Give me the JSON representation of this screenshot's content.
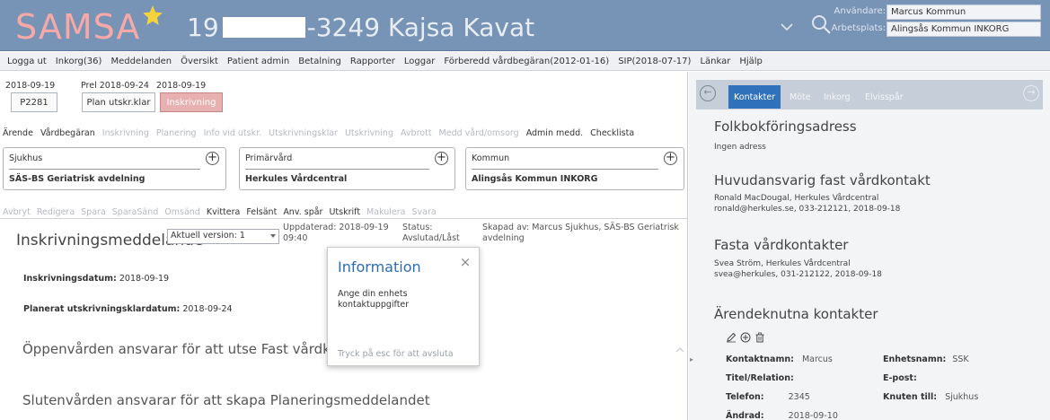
{
  "header": {
    "logo": "SAMSA",
    "pnr_prefix": "19",
    "pnr_suffix": "-3249 Kajsa Kavat",
    "user_label": "Användare:",
    "user_value": "Marcus Kommun",
    "workplace_label": "Arbetsplats:",
    "workplace_value": "Alingsås Kommun INKORG",
    "icons": [
      "star-icon",
      "chevron-down-icon",
      "search-icon"
    ],
    "colors": {
      "bar": "#7793b6",
      "logo": "#f6a9a6",
      "star": "#f7d33a"
    }
  },
  "menu": [
    "Logga ut",
    "Inkorg(36)",
    "Meddelanden",
    "Översikt",
    "Patient admin",
    "Betalning",
    "Rapporter",
    "Loggar",
    "Förberedd vårdbegäran(2012-01-16)",
    "SIP(2018-07-17)",
    "Länkar",
    "Hjälp"
  ],
  "dates": {
    "d1": "2018-09-19",
    "d2": "Prel 2018-09-24",
    "d3": "2018-09-19",
    "b1": "P2281",
    "b2": "Plan utskr.klar",
    "b3": "Inskrivning"
  },
  "tabs1": [
    {
      "label": "Ärende",
      "enabled": true
    },
    {
      "label": "Vårdbegäran",
      "enabled": true
    },
    {
      "label": "Inskrivning",
      "enabled": false
    },
    {
      "label": "Planering",
      "enabled": false
    },
    {
      "label": "Info vid utskr.",
      "enabled": false
    },
    {
      "label": "Utskrivningsklar",
      "enabled": false
    },
    {
      "label": "Utskrivning",
      "enabled": false
    },
    {
      "label": "Avbrott",
      "enabled": false
    },
    {
      "label": "Medd vård/omsorg",
      "enabled": false
    },
    {
      "label": "Admin medd.",
      "enabled": true
    },
    {
      "label": "Checklista",
      "enabled": true
    }
  ],
  "units": [
    {
      "label": "Sjukhus",
      "value": "SÄS-BS Geriatrisk avdelning"
    },
    {
      "label": "Primärvård",
      "value": "Herkules Vårdcentral"
    },
    {
      "label": "Kommun",
      "value": "Alingsås Kommun INKORG"
    }
  ],
  "tabs2": [
    {
      "label": "Avbryt",
      "enabled": false
    },
    {
      "label": "Redigera",
      "enabled": false
    },
    {
      "label": "Spara",
      "enabled": false
    },
    {
      "label": "SparaSänd",
      "enabled": false
    },
    {
      "label": "Omsänd",
      "enabled": false
    },
    {
      "label": "Kvittera",
      "enabled": true
    },
    {
      "label": "Felsänt",
      "enabled": true
    },
    {
      "label": "Anv. spår",
      "enabled": true
    },
    {
      "label": "Utskrift",
      "enabled": true
    },
    {
      "label": "Makulera",
      "enabled": false
    },
    {
      "label": "Svara",
      "enabled": false
    }
  ],
  "document": {
    "title": "Inskrivningsmeddelande",
    "version": "Aktuell version: 1",
    "updated_l1": "Uppdaterad: 2018-09-19",
    "updated_l2": "09:40",
    "status_l1": "Status:",
    "status_l2": "Avslutad/Låst",
    "created_l1": "Skapad av: Marcus Sjukhus, SÄS-BS Geriatrisk",
    "created_l2": "avdelning",
    "f1_label": "Inskrivningsdatum:",
    "f1_value": "2018-09-19",
    "f2_label": "Planerat utskrivningsklardatum:",
    "f2_value": "2018-09-24",
    "text1": "Öppenvården ansvarar för att utse Fast vårdkontakt",
    "text2": "Slutenvården ansvarar för att skapa Planeringsmeddelandet"
  },
  "dialog": {
    "title": "Information",
    "message": "Ange din enhets kontaktuppgifter",
    "footer": "Tryck på esc för att avsluta"
  },
  "right": {
    "tabs": [
      "Kontakter",
      "Möte",
      "Inkorg",
      "Elvisspår"
    ],
    "s1_title": "Folkbokföringsadress",
    "s1_text": "Ingen adress",
    "s2_title": "Huvudansvarig fast vårdkontakt",
    "s2_l1": "Ronald MacDougal, Herkules Vårdcentral",
    "s2_l2": "ronald@herkules.se, 033-212121, 2018-09-18",
    "s3_title": "Fasta vårdkontakter",
    "s3_l1": "Svea Ström, Herkules Vårdcentral",
    "s3_l2": "svea@herkules, 031-212122, 2018-09-18",
    "s4_title": "Ärendeknutna kontakter",
    "contact": {
      "name_label": "Kontaktnamn:",
      "name": "Marcus",
      "unit_label": "Enhetsnamn:",
      "unit": "SSK",
      "title_label": "Titel/Relation:",
      "title": "",
      "email_label": "E-post:",
      "email": "",
      "phone_label": "Telefon:",
      "phone": "2345",
      "linked_label": "Knuten till:",
      "linked": "Sjukhus",
      "changed_label": "Ändrad:",
      "changed": "2018-09-10"
    }
  }
}
